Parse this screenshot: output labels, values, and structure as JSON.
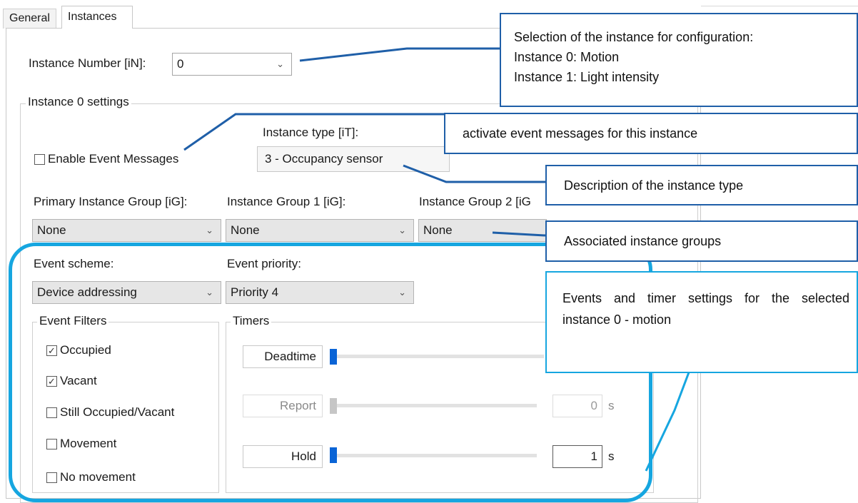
{
  "tabs": [
    {
      "label": "General"
    },
    {
      "label": "Instances"
    }
  ],
  "instance_number": {
    "label": "Instance Number [iN]:",
    "value": "0"
  },
  "settings_group": {
    "title": "Instance 0 settings"
  },
  "enable_event_messages": {
    "label": "Enable Event Messages",
    "checked": false
  },
  "instance_type": {
    "label": "Instance type [iT]:",
    "value": "3 - Occupancy sensor"
  },
  "groups": [
    {
      "label": "Primary Instance Group [iG]:",
      "value": "None"
    },
    {
      "label": "Instance Group 1 [iG]:",
      "value": "None"
    },
    {
      "label": "Instance Group 2 [iG",
      "value": "None"
    }
  ],
  "event_scheme": {
    "label": "Event scheme:",
    "value": "Device addressing"
  },
  "event_priority": {
    "label": "Event priority:",
    "value": "Priority 4"
  },
  "event_filters": {
    "title": "Event Filters",
    "items": [
      {
        "label": "Occupied",
        "checked": true
      },
      {
        "label": "Vacant",
        "checked": true
      },
      {
        "label": "Still Occupied/Vacant",
        "checked": false
      },
      {
        "label": "Movement",
        "checked": false
      },
      {
        "label": "No movement",
        "checked": false
      }
    ]
  },
  "timers": {
    "title": "Timers",
    "items": [
      {
        "label": "Deadtime",
        "enabled": true,
        "value": "",
        "unit": ""
      },
      {
        "label": "Report",
        "enabled": false,
        "value": "0",
        "unit": "s"
      },
      {
        "label": "Hold",
        "enabled": true,
        "value": "1",
        "unit": "s"
      }
    ]
  },
  "callouts": {
    "instance_selection": [
      "Selection of the instance for configuration:",
      "Instance 0: Motion",
      "Instance 1: Light intensity"
    ],
    "event_messages": "activate event messages for this instance",
    "instance_type_desc": "Description of the instance type",
    "groups_desc": "Associated instance groups",
    "events_desc": "Events and timer settings for the selected instance 0 - motion"
  },
  "colors": {
    "callout_border": "#1f5fa8",
    "highlight": "#16a6e0",
    "slider_thumb": "#0a64d6"
  }
}
